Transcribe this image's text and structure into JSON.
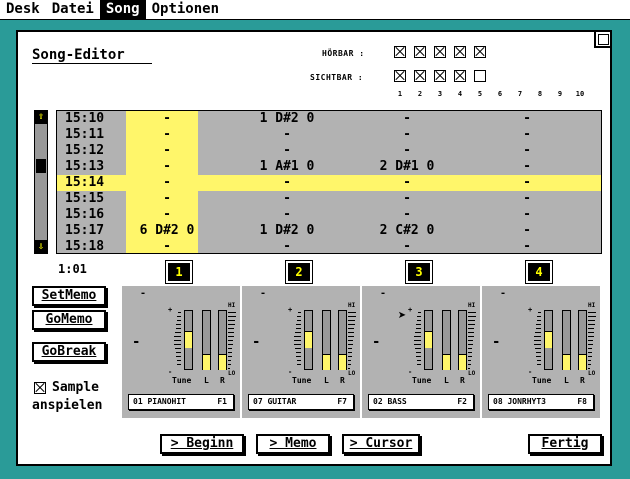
{
  "menu": [
    "Desk",
    "Datei",
    "Song",
    "Optionen"
  ],
  "active_menu": "Song",
  "editor": {
    "title": "Song-Editor",
    "hoerbar_label": "HÖRBAR :",
    "sichtbar_label": "SICHTBAR :",
    "hoerbar_checked": [
      true,
      true,
      true,
      true,
      true
    ],
    "sichtbar_checked": [
      true,
      true,
      true,
      true,
      false
    ],
    "track_numbers": [
      "1",
      "2",
      "3",
      "4",
      "5",
      "6",
      "7",
      "8",
      "9",
      "10"
    ],
    "scroll_up_icon": "arrow-up-icon",
    "scroll_down_icon": "arrow-down-icon"
  },
  "rows": [
    {
      "pos": "15:10",
      "c1": "-",
      "c2": "1 D#2 0",
      "c3": "-",
      "c4": "-"
    },
    {
      "pos": "15:11",
      "c1": "-",
      "c2": "-",
      "c3": "-",
      "c4": "-"
    },
    {
      "pos": "15:12",
      "c1": "-",
      "c2": "-",
      "c3": "-",
      "c4": "-"
    },
    {
      "pos": "15:13",
      "c1": "-",
      "c2": "1 A#1 0",
      "c3": "2 D#1 0",
      "c4": "-"
    },
    {
      "pos": "15:14",
      "c1": "-",
      "c2": "-",
      "c3": "-",
      "c4": "-"
    },
    {
      "pos": "15:15",
      "c1": "-",
      "c2": "-",
      "c3": "-",
      "c4": "-"
    },
    {
      "pos": "15:16",
      "c1": "-",
      "c2": "-",
      "c3": "-",
      "c4": "-"
    },
    {
      "pos": "15:17",
      "c1": "6 D#2 0",
      "c2": "1 D#2 0",
      "c3": "2 C#2 0",
      "c4": "-"
    },
    {
      "pos": "15:18",
      "c1": "-",
      "c2": "-",
      "c3": "-",
      "c4": "-"
    }
  ],
  "highlighted_row": "15:14",
  "counter": "1:01",
  "channels": [
    {
      "num": "1",
      "instrument": "01 PIANOHIT",
      "key": "F1",
      "tune": 0.5,
      "left": 0.25,
      "right": 0.25
    },
    {
      "num": "2",
      "instrument": "07 GUITAR",
      "key": "F7",
      "tune": 0.5,
      "left": 0.25,
      "right": 0.25
    },
    {
      "num": "3",
      "instrument": "02 BASS",
      "key": "F2",
      "tune": 0.5,
      "left": 0.25,
      "right": 0.25
    },
    {
      "num": "4",
      "instrument": "08 JONRHYT3",
      "key": "F8",
      "tune": 0.5,
      "left": 0.25,
      "right": 0.25
    }
  ],
  "mixer_labels": {
    "tune": "Tune",
    "l": "L",
    "r": "R",
    "hi": "HI",
    "lo": "LO",
    "plus": "+",
    "minus": "-",
    "dash": "-"
  },
  "buttons": {
    "setmemo": "SetMemo",
    "gomemo": "GoMemo",
    "gobreak": "GoBreak",
    "beginn": "> Beginn",
    "memo": "> Memo",
    "cursor": "> Cursor",
    "fertig": "Fertig"
  },
  "sample": {
    "checked": true,
    "label_line1": "Sample",
    "label_line2": "anspielen"
  }
}
